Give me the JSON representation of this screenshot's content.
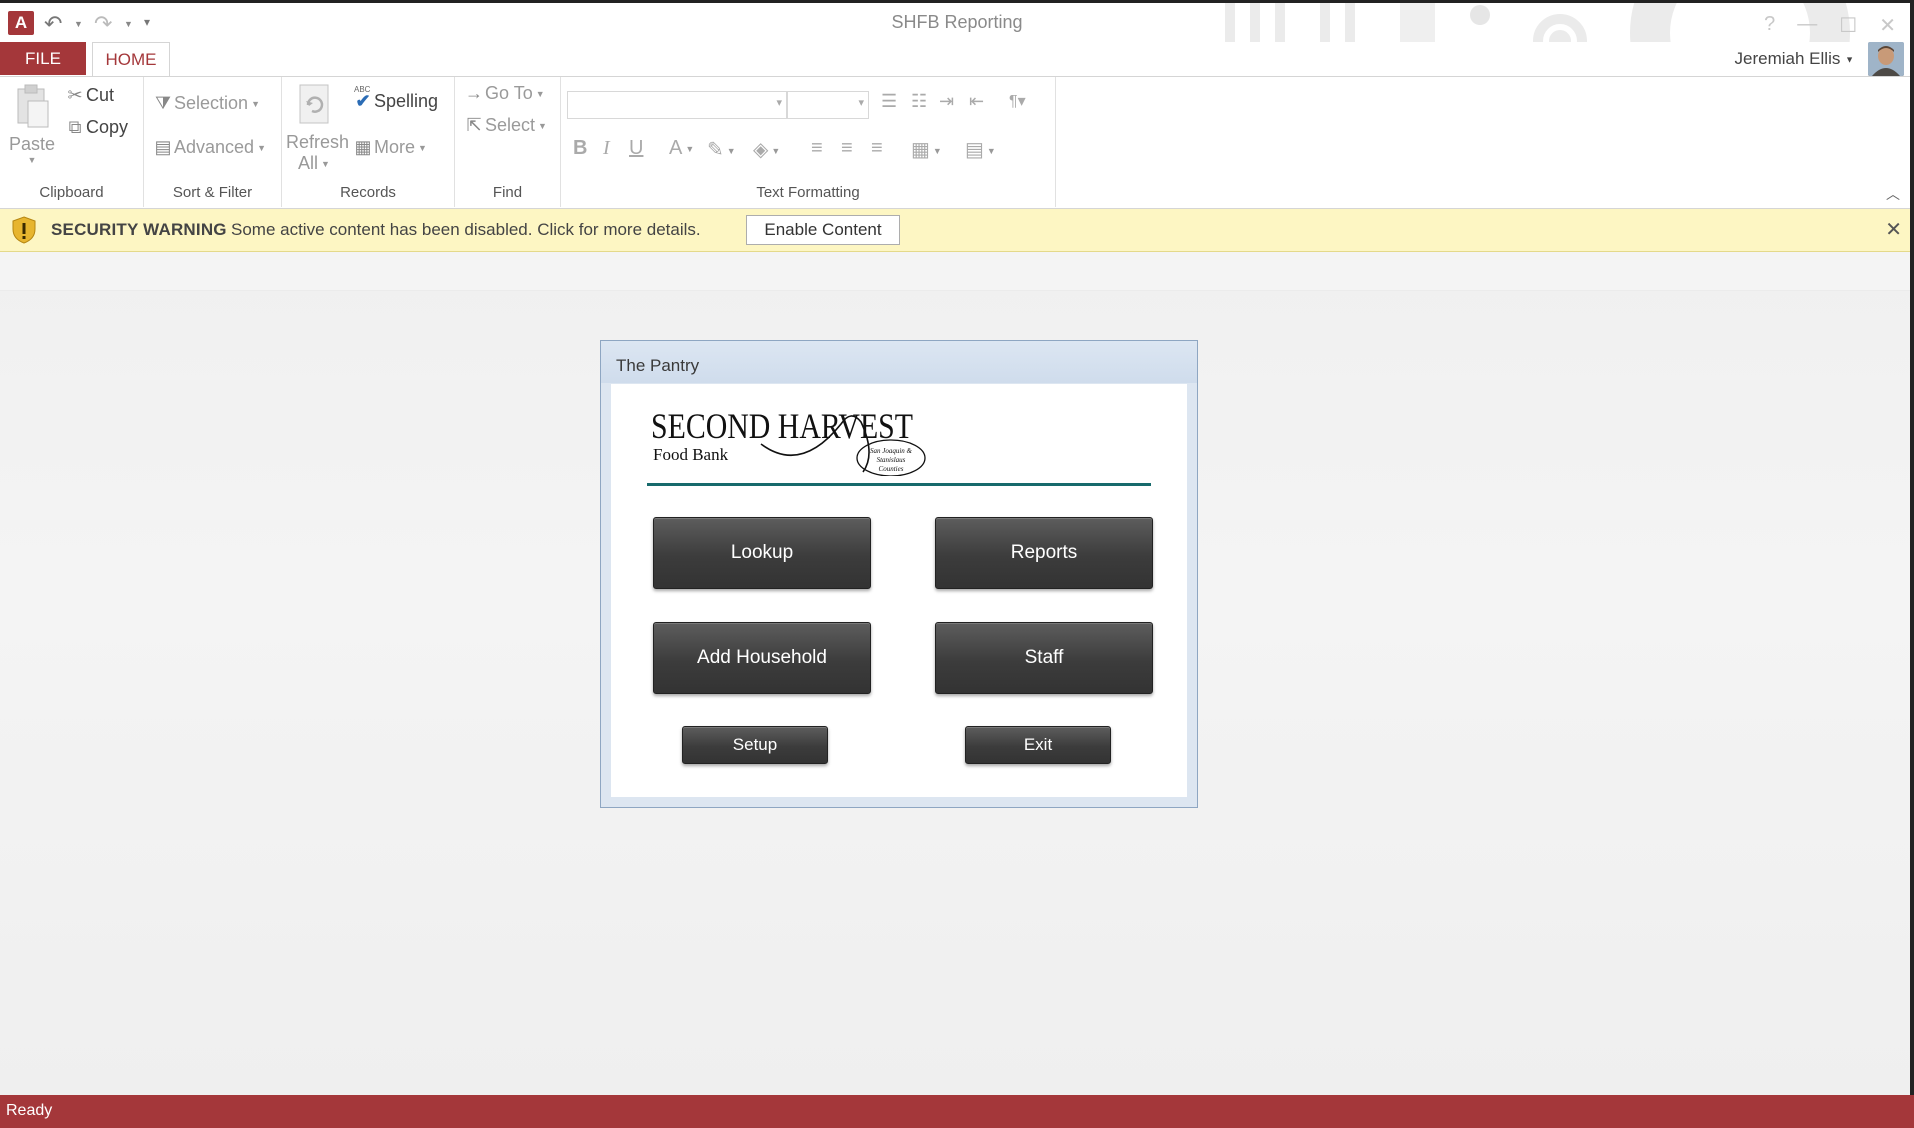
{
  "window": {
    "title": "SHFB Reporting",
    "app_icon_letter": "A",
    "controls": [
      "?",
      "—",
      "☐",
      "✕"
    ]
  },
  "ribbon_tabs": {
    "file": "FILE",
    "home": "HOME"
  },
  "user": {
    "name": "Jeremiah Ellis"
  },
  "ribbon": {
    "clipboard": {
      "label": "Clipboard",
      "paste": "Paste",
      "cut": "Cut",
      "copy": "Copy"
    },
    "sort_filter": {
      "label": "Sort & Filter",
      "selection": "Selection",
      "advanced": "Advanced"
    },
    "records": {
      "label": "Records",
      "refresh_line1": "Refresh",
      "refresh_line2": "All",
      "spelling": "Spelling",
      "spelling_abc": "ABC",
      "more": "More"
    },
    "find": {
      "label": "Find",
      "goto": "Go To",
      "select": "Select"
    },
    "text_formatting": {
      "label": "Text Formatting",
      "bold": "B",
      "italic": "I",
      "underline": "U",
      "font_color": "A"
    }
  },
  "security_bar": {
    "title": "SECURITY WARNING",
    "message": "Some active content has been disabled. Click for more details.",
    "button": "Enable Content"
  },
  "form": {
    "title": "The Pantry",
    "logo": {
      "line1": "SECOND HARVEST",
      "line2": "Food Bank",
      "tagline_1": "San Joaquin &",
      "tagline_2": "Stanislaus",
      "tagline_3": "Counties"
    },
    "buttons": {
      "lookup": "Lookup",
      "reports": "Reports",
      "add_household": "Add Household",
      "staff": "Staff",
      "setup": "Setup",
      "exit": "Exit"
    }
  },
  "status": {
    "text": "Ready"
  },
  "colors": {
    "accent": "#a4373a",
    "warning_bar": "#fdf6c3",
    "logo_rule": "#176a6c",
    "button_dark": "#3c3c3c"
  }
}
